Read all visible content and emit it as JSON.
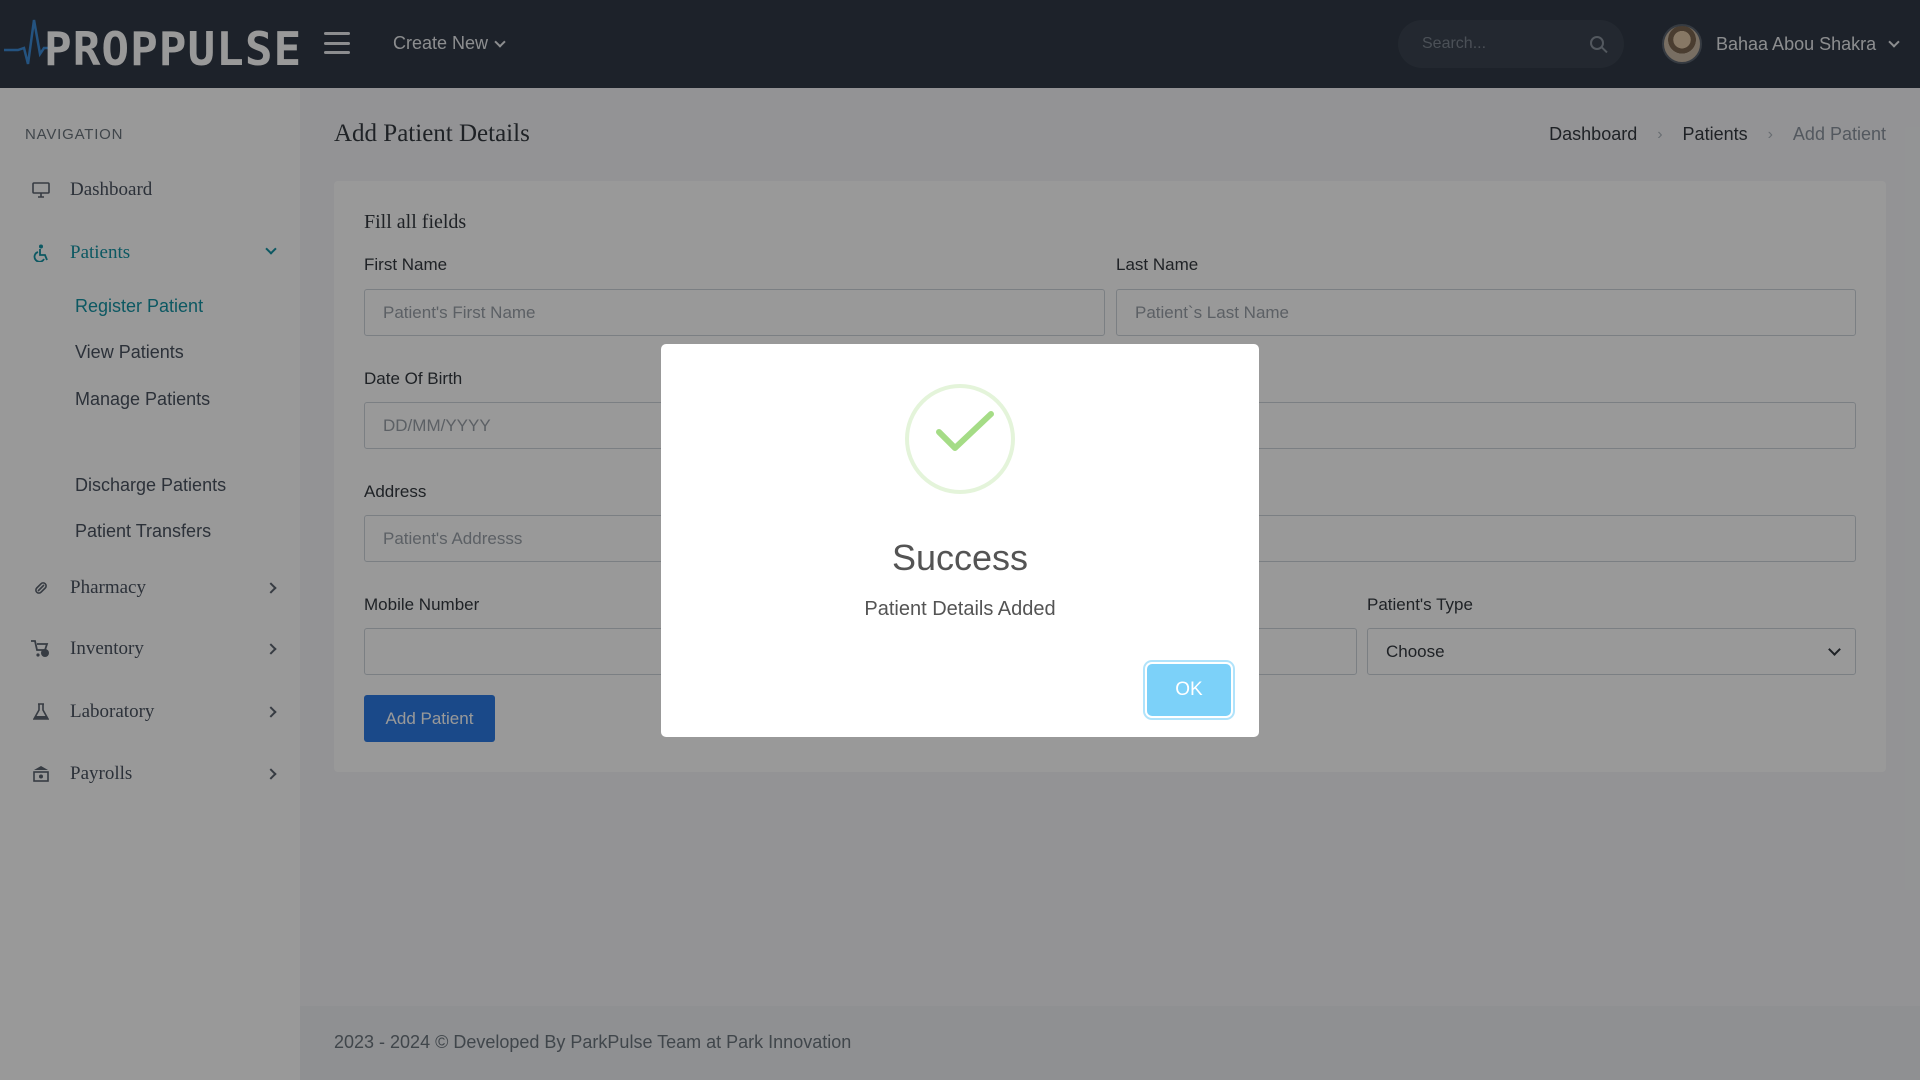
{
  "app": {
    "logo_text": "PROPPULSE"
  },
  "header": {
    "create_new_label": "Create New",
    "search_placeholder": "Search...",
    "user_name": "Bahaa Abou Shakra"
  },
  "sidebar": {
    "title": "NAVIGATION",
    "items": [
      {
        "label": "Dashboard",
        "icon": "monitor-icon"
      },
      {
        "label": "Patients",
        "icon": "wheelchair-icon",
        "active": true
      },
      {
        "label": "Pharmacy",
        "icon": "pill-icon"
      },
      {
        "label": "Inventory",
        "icon": "cart-icon"
      },
      {
        "label": "Laboratory",
        "icon": "flask-icon"
      },
      {
        "label": "Payrolls",
        "icon": "bank-icon"
      }
    ],
    "patients_sub": [
      {
        "label": "Register Patient",
        "active": true
      },
      {
        "label": "View Patients"
      },
      {
        "label": "Manage Patients"
      },
      {
        "label": "Discharge Patients"
      },
      {
        "label": "Patient Transfers"
      }
    ]
  },
  "page": {
    "title": "Add Patient Details",
    "breadcrumb": [
      "Dashboard",
      "Patients",
      "Add Patient"
    ]
  },
  "form": {
    "heading": "Fill all fields",
    "first_name": {
      "label": "First Name",
      "placeholder": "Patient's First Name"
    },
    "last_name": {
      "label": "Last Name",
      "placeholder": "Patient`s Last Name"
    },
    "dob": {
      "label": "Date Of Birth",
      "placeholder": "DD/MM/YYYY"
    },
    "address": {
      "label": "Address",
      "placeholder": "Patient's Addresss"
    },
    "mobile": {
      "label": "Mobile Number",
      "placeholder": ""
    },
    "patient_type": {
      "label": "Patient's Type",
      "value": "Choose"
    },
    "submit_label": "Add Patient"
  },
  "modal": {
    "title": "Success",
    "message": "Patient Details Added",
    "ok_label": "OK",
    "icon": "success-check-icon"
  },
  "footer": {
    "text": "2023 - 2024 © Developed By ParkPulse Team at Park Innovation"
  },
  "colors": {
    "topbar": "#313a46",
    "accent": "#1593a3",
    "primary_button": "#2c7be5",
    "ok_button": "#7cd1f9",
    "success_green": "#a5dc86"
  }
}
